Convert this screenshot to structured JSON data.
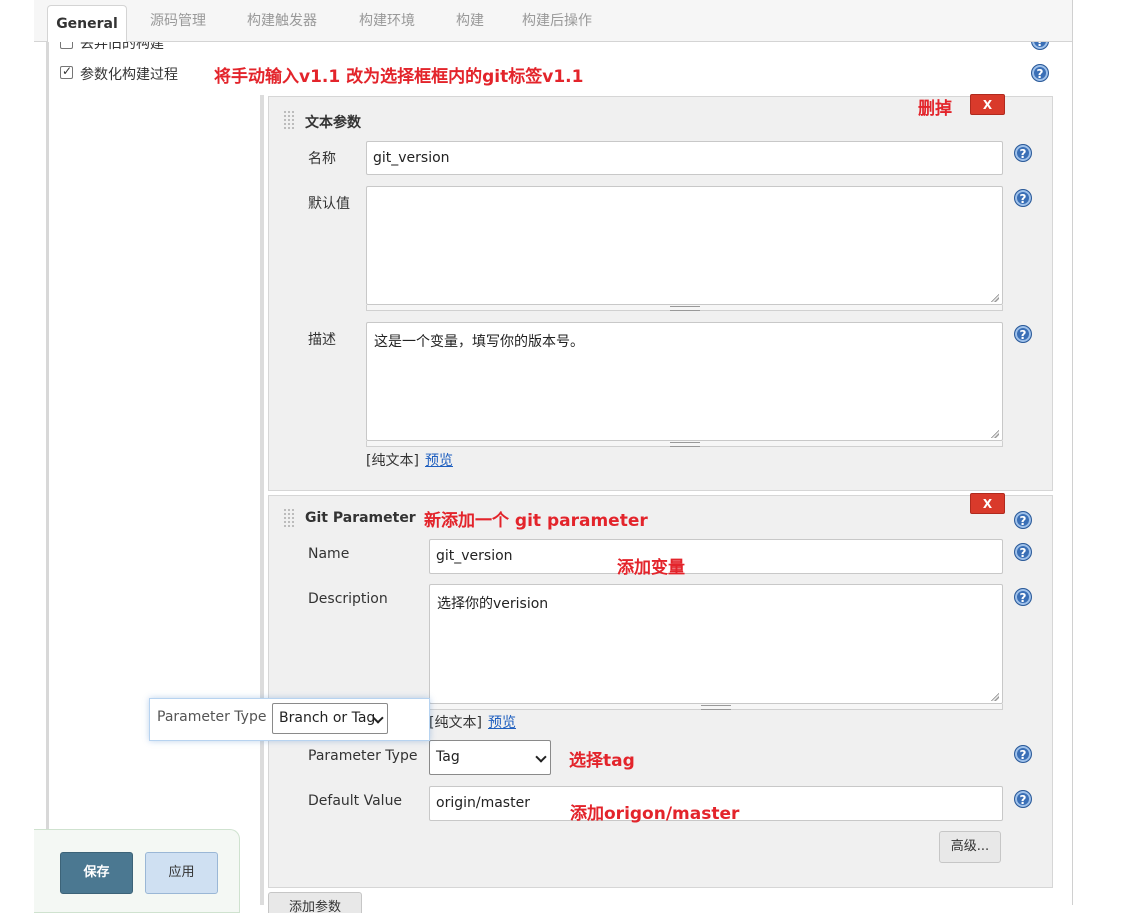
{
  "tabs": [
    {
      "label": "General",
      "active": true
    },
    {
      "label": "源码管理"
    },
    {
      "label": "构建触发器"
    },
    {
      "label": "构建环境"
    },
    {
      "label": "构建"
    },
    {
      "label": "构建后操作"
    }
  ],
  "options": {
    "discard_old": {
      "label": "丢弃旧的构建",
      "checked": false
    },
    "parameterized": {
      "label": "参数化构建过程",
      "checked": true
    }
  },
  "annotations": {
    "top_note": "将手动输入v1.1  改为选择框框内的git标签v1.1",
    "delete_note": "删掉",
    "git_param_note": "新添加一个 git parameter",
    "add_var_note": "添加变量",
    "select_tag_note": "选择tag",
    "default_note": "添加origon/master",
    "color": "#e3242b"
  },
  "text_param": {
    "title": "文本参数",
    "delete_label": "X",
    "name_label": "名称",
    "name_value": "git_version",
    "default_label": "默认值",
    "default_value": "",
    "desc_label": "描述",
    "desc_value": "这是一个变量，填写你的版本号。",
    "plain_text": "[纯文本]",
    "preview": "预览"
  },
  "git_param": {
    "title": "Git Parameter",
    "delete_label": "X",
    "name_label": "Name",
    "name_value": "git_version",
    "desc_label": "Description",
    "desc_value": "选择你的verision",
    "plain_text": "[纯文本]",
    "preview": "预览",
    "type_label": "Parameter Type",
    "type_value": "Tag",
    "default_label": "Default Value",
    "default_value": "origin/master",
    "advanced": "高级..."
  },
  "popup": {
    "label": "Parameter Type",
    "value": "Branch or Tag"
  },
  "help_glyph": "?",
  "add_param": "添加参数",
  "buttons": {
    "save": "保存",
    "apply": "应用"
  },
  "colors": {
    "save_bg": "#4b7891",
    "apply_bg": "#cfe0f2",
    "delete_bg": "#d93a2b",
    "help_bg": "#3a6fb6"
  }
}
